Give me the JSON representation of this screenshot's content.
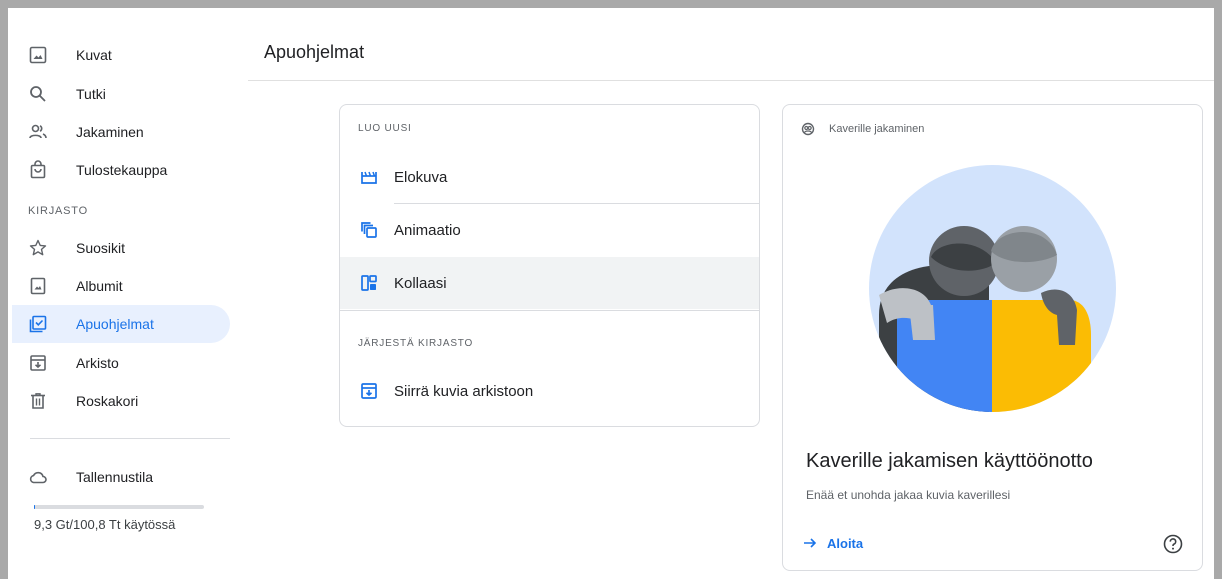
{
  "sidebar": {
    "items": [
      {
        "label": "Kuvat",
        "icon": "photo-icon"
      },
      {
        "label": "Tutki",
        "icon": "search-icon"
      },
      {
        "label": "Jakaminen",
        "icon": "people-icon"
      },
      {
        "label": "Tulostekauppa",
        "icon": "shopping-bag-icon"
      }
    ],
    "library_label": "KIRJASTO",
    "library_items": [
      {
        "label": "Suosikit",
        "icon": "star-icon"
      },
      {
        "label": "Albumit",
        "icon": "album-icon"
      },
      {
        "label": "Apuohjelmat",
        "icon": "utilities-icon",
        "active": true
      },
      {
        "label": "Arkisto",
        "icon": "archive-icon"
      },
      {
        "label": "Roskakori",
        "icon": "trash-icon"
      }
    ],
    "storage": {
      "label": "Tallennustila",
      "icon": "cloud-icon",
      "usage_text": "9,3 Gt/100,8 Tt käytössä",
      "used_fraction": 0.0001
    }
  },
  "header": {
    "title": "Apuohjelmat"
  },
  "create": {
    "section_label": "LUO UUSI",
    "items": [
      {
        "label": "Elokuva",
        "icon": "movie-icon"
      },
      {
        "label": "Animaatio",
        "icon": "animation-icon"
      },
      {
        "label": "Kollaasi",
        "icon": "collage-icon",
        "hovered": true
      }
    ],
    "organize_label": "JÄRJESTÄ KIRJASTO",
    "organize_items": [
      {
        "label": "Siirrä kuvia arkistoon",
        "icon": "archive-icon"
      }
    ]
  },
  "promo": {
    "header_label": "Kaverille jakaminen",
    "header_icon": "partner-sharing-icon",
    "title": "Kaverille jakamisen käyttöönotto",
    "subtitle": "Enää et unohda jakaa kuvia kaverillesi",
    "action_label": "Aloita",
    "action_icon": "arrow-right-icon",
    "help_icon": "help-icon"
  },
  "colors": {
    "accent": "#1a73e8",
    "active_bg": "#e8f0fe",
    "hover_bg": "#f1f3f4",
    "illustration_bg": "#d2e3fc",
    "illustration_blue": "#4285f4",
    "illustration_yellow": "#fbbc04"
  }
}
